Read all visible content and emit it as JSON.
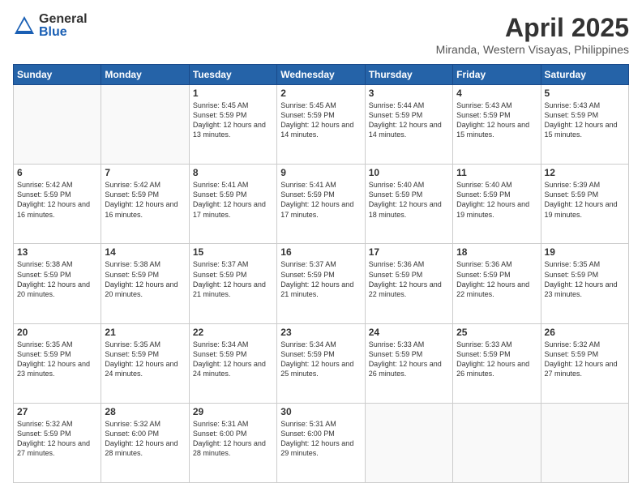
{
  "logo": {
    "general": "General",
    "blue": "Blue"
  },
  "header": {
    "month": "April 2025",
    "location": "Miranda, Western Visayas, Philippines"
  },
  "weekdays": [
    "Sunday",
    "Monday",
    "Tuesday",
    "Wednesday",
    "Thursday",
    "Friday",
    "Saturday"
  ],
  "weeks": [
    [
      {
        "day": "",
        "sunrise": "",
        "sunset": "",
        "daylight": ""
      },
      {
        "day": "",
        "sunrise": "",
        "sunset": "",
        "daylight": ""
      },
      {
        "day": "1",
        "sunrise": "Sunrise: 5:45 AM",
        "sunset": "Sunset: 5:59 PM",
        "daylight": "Daylight: 12 hours and 13 minutes."
      },
      {
        "day": "2",
        "sunrise": "Sunrise: 5:45 AM",
        "sunset": "Sunset: 5:59 PM",
        "daylight": "Daylight: 12 hours and 14 minutes."
      },
      {
        "day": "3",
        "sunrise": "Sunrise: 5:44 AM",
        "sunset": "Sunset: 5:59 PM",
        "daylight": "Daylight: 12 hours and 14 minutes."
      },
      {
        "day": "4",
        "sunrise": "Sunrise: 5:43 AM",
        "sunset": "Sunset: 5:59 PM",
        "daylight": "Daylight: 12 hours and 15 minutes."
      },
      {
        "day": "5",
        "sunrise": "Sunrise: 5:43 AM",
        "sunset": "Sunset: 5:59 PM",
        "daylight": "Daylight: 12 hours and 15 minutes."
      }
    ],
    [
      {
        "day": "6",
        "sunrise": "Sunrise: 5:42 AM",
        "sunset": "Sunset: 5:59 PM",
        "daylight": "Daylight: 12 hours and 16 minutes."
      },
      {
        "day": "7",
        "sunrise": "Sunrise: 5:42 AM",
        "sunset": "Sunset: 5:59 PM",
        "daylight": "Daylight: 12 hours and 16 minutes."
      },
      {
        "day": "8",
        "sunrise": "Sunrise: 5:41 AM",
        "sunset": "Sunset: 5:59 PM",
        "daylight": "Daylight: 12 hours and 17 minutes."
      },
      {
        "day": "9",
        "sunrise": "Sunrise: 5:41 AM",
        "sunset": "Sunset: 5:59 PM",
        "daylight": "Daylight: 12 hours and 17 minutes."
      },
      {
        "day": "10",
        "sunrise": "Sunrise: 5:40 AM",
        "sunset": "Sunset: 5:59 PM",
        "daylight": "Daylight: 12 hours and 18 minutes."
      },
      {
        "day": "11",
        "sunrise": "Sunrise: 5:40 AM",
        "sunset": "Sunset: 5:59 PM",
        "daylight": "Daylight: 12 hours and 19 minutes."
      },
      {
        "day": "12",
        "sunrise": "Sunrise: 5:39 AM",
        "sunset": "Sunset: 5:59 PM",
        "daylight": "Daylight: 12 hours and 19 minutes."
      }
    ],
    [
      {
        "day": "13",
        "sunrise": "Sunrise: 5:38 AM",
        "sunset": "Sunset: 5:59 PM",
        "daylight": "Daylight: 12 hours and 20 minutes."
      },
      {
        "day": "14",
        "sunrise": "Sunrise: 5:38 AM",
        "sunset": "Sunset: 5:59 PM",
        "daylight": "Daylight: 12 hours and 20 minutes."
      },
      {
        "day": "15",
        "sunrise": "Sunrise: 5:37 AM",
        "sunset": "Sunset: 5:59 PM",
        "daylight": "Daylight: 12 hours and 21 minutes."
      },
      {
        "day": "16",
        "sunrise": "Sunrise: 5:37 AM",
        "sunset": "Sunset: 5:59 PM",
        "daylight": "Daylight: 12 hours and 21 minutes."
      },
      {
        "day": "17",
        "sunrise": "Sunrise: 5:36 AM",
        "sunset": "Sunset: 5:59 PM",
        "daylight": "Daylight: 12 hours and 22 minutes."
      },
      {
        "day": "18",
        "sunrise": "Sunrise: 5:36 AM",
        "sunset": "Sunset: 5:59 PM",
        "daylight": "Daylight: 12 hours and 22 minutes."
      },
      {
        "day": "19",
        "sunrise": "Sunrise: 5:35 AM",
        "sunset": "Sunset: 5:59 PM",
        "daylight": "Daylight: 12 hours and 23 minutes."
      }
    ],
    [
      {
        "day": "20",
        "sunrise": "Sunrise: 5:35 AM",
        "sunset": "Sunset: 5:59 PM",
        "daylight": "Daylight: 12 hours and 23 minutes."
      },
      {
        "day": "21",
        "sunrise": "Sunrise: 5:35 AM",
        "sunset": "Sunset: 5:59 PM",
        "daylight": "Daylight: 12 hours and 24 minutes."
      },
      {
        "day": "22",
        "sunrise": "Sunrise: 5:34 AM",
        "sunset": "Sunset: 5:59 PM",
        "daylight": "Daylight: 12 hours and 24 minutes."
      },
      {
        "day": "23",
        "sunrise": "Sunrise: 5:34 AM",
        "sunset": "Sunset: 5:59 PM",
        "daylight": "Daylight: 12 hours and 25 minutes."
      },
      {
        "day": "24",
        "sunrise": "Sunrise: 5:33 AM",
        "sunset": "Sunset: 5:59 PM",
        "daylight": "Daylight: 12 hours and 26 minutes."
      },
      {
        "day": "25",
        "sunrise": "Sunrise: 5:33 AM",
        "sunset": "Sunset: 5:59 PM",
        "daylight": "Daylight: 12 hours and 26 minutes."
      },
      {
        "day": "26",
        "sunrise": "Sunrise: 5:32 AM",
        "sunset": "Sunset: 5:59 PM",
        "daylight": "Daylight: 12 hours and 27 minutes."
      }
    ],
    [
      {
        "day": "27",
        "sunrise": "Sunrise: 5:32 AM",
        "sunset": "Sunset: 5:59 PM",
        "daylight": "Daylight: 12 hours and 27 minutes."
      },
      {
        "day": "28",
        "sunrise": "Sunrise: 5:32 AM",
        "sunset": "Sunset: 6:00 PM",
        "daylight": "Daylight: 12 hours and 28 minutes."
      },
      {
        "day": "29",
        "sunrise": "Sunrise: 5:31 AM",
        "sunset": "Sunset: 6:00 PM",
        "daylight": "Daylight: 12 hours and 28 minutes."
      },
      {
        "day": "30",
        "sunrise": "Sunrise: 5:31 AM",
        "sunset": "Sunset: 6:00 PM",
        "daylight": "Daylight: 12 hours and 29 minutes."
      },
      {
        "day": "",
        "sunrise": "",
        "sunset": "",
        "daylight": ""
      },
      {
        "day": "",
        "sunrise": "",
        "sunset": "",
        "daylight": ""
      },
      {
        "day": "",
        "sunrise": "",
        "sunset": "",
        "daylight": ""
      }
    ]
  ]
}
